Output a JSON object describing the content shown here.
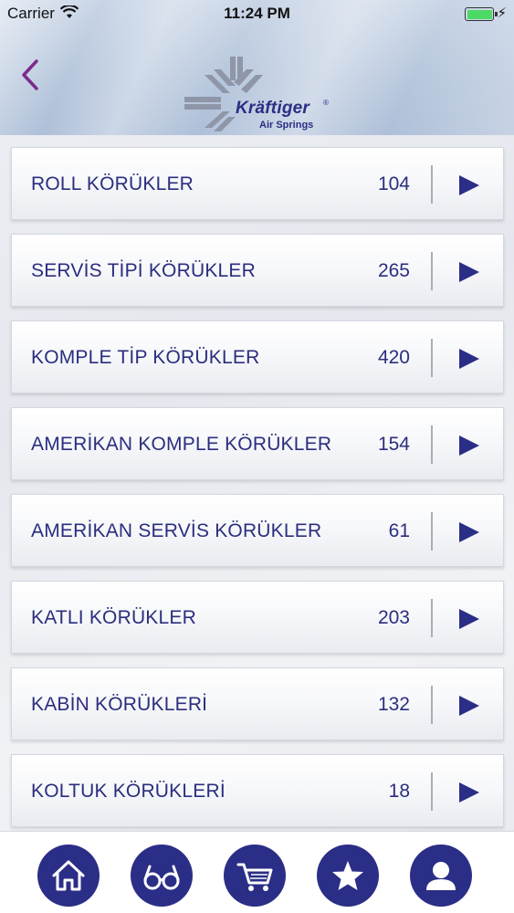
{
  "status_bar": {
    "carrier": "Carrier",
    "time": "11:24 PM",
    "battery_level_percent": 100
  },
  "header": {
    "back_icon": "chevron-left-icon",
    "logo": {
      "name": "Kräftiger",
      "registered": "®",
      "subtitle": "Air Springs"
    }
  },
  "colors": {
    "brand": "#2b2e86",
    "back_arrow": "#7b2a8c",
    "battery": "#4cd964"
  },
  "categories": [
    {
      "label": "ROLL KÖRÜKLER",
      "count": "104"
    },
    {
      "label": "SERVİS TİPİ KÖRÜKLER",
      "count": "265"
    },
    {
      "label": "KOMPLE TİP KÖRÜKLER",
      "count": "420"
    },
    {
      "label": "AMERİKAN KOMPLE KÖRÜKLER",
      "count": "154"
    },
    {
      "label": "AMERİKAN SERVİS KÖRÜKLER",
      "count": "61"
    },
    {
      "label": "KATLI KÖRÜKLER",
      "count": "203"
    },
    {
      "label": "KABİN KÖRÜKLERİ",
      "count": "132"
    },
    {
      "label": "KOLTUK KÖRÜKLERİ",
      "count": "18"
    }
  ],
  "tabbar": {
    "items": [
      {
        "icon": "home-icon"
      },
      {
        "icon": "glasses-icon"
      },
      {
        "icon": "cart-icon"
      },
      {
        "icon": "star-icon"
      },
      {
        "icon": "user-icon"
      }
    ]
  }
}
